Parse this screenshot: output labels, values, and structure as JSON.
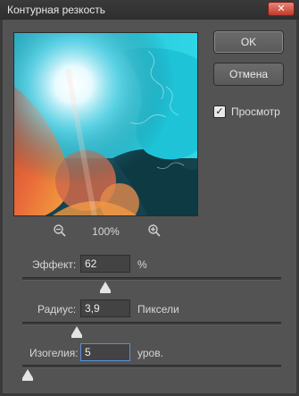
{
  "window": {
    "title": "Контурная резкость",
    "close_glyph": "✕"
  },
  "preview": {
    "zoom_level": "100%",
    "zoom_out_icon": "zoom-out-icon",
    "zoom_in_icon": "zoom-in-icon"
  },
  "buttons": {
    "ok_label": "OK",
    "cancel_label": "Отмена"
  },
  "preview_checkbox": {
    "label": "Просмотр",
    "checked": true,
    "check_glyph": "✓"
  },
  "params": {
    "amount": {
      "label": "Эффект:",
      "value": "62",
      "unit": "%",
      "slider_fraction": 0.32
    },
    "radius": {
      "label": "Радиус:",
      "value": "3,9",
      "unit": "Пиксели",
      "slider_fraction": 0.21
    },
    "threshold": {
      "label": "Изогелия:",
      "value": "5",
      "unit": "уров.",
      "slider_fraction": 0.02
    }
  },
  "colors": {
    "dialog_bg": "#535353",
    "titlebar_bg": "#2e2e2e",
    "close_btn": "#c0392b",
    "focus_border": "#5a8fd8"
  }
}
